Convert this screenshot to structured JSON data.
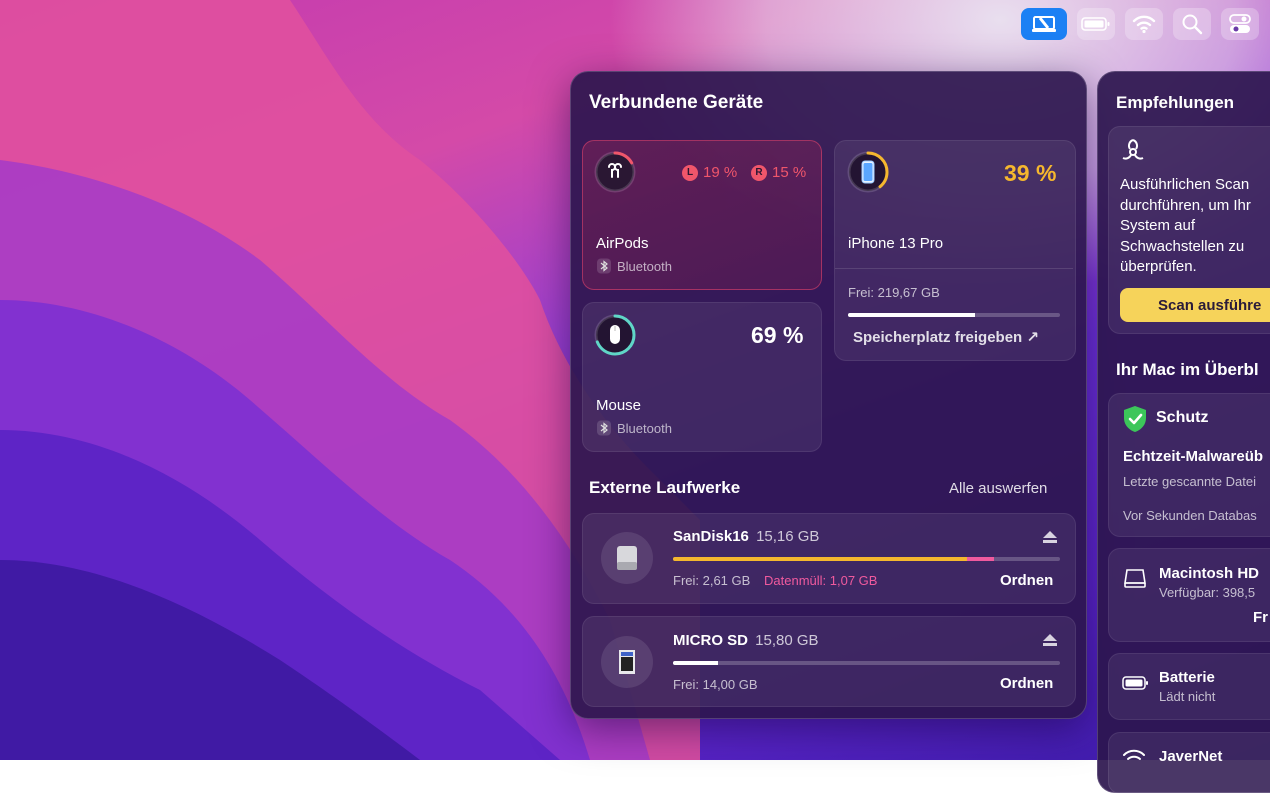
{
  "menubar": {
    "icons": [
      "clean-my-mac-icon",
      "battery-icon",
      "wifi-icon",
      "search-icon",
      "control-center-icon"
    ]
  },
  "connected": {
    "title": "Verbundene Geräte",
    "airpods": {
      "name": "AirPods",
      "connection": "Bluetooth",
      "left_label": "L",
      "left_pct": "19 %",
      "right_label": "R",
      "right_pct": "15 %",
      "ring_level": 0.17,
      "color": "#f0566b"
    },
    "iphone": {
      "name": "iPhone 13 Pro",
      "pct": "39 %",
      "level": 0.39,
      "color": "#f5b72e",
      "free": "Frei: 219,67 GB",
      "free_level": 0.6,
      "action": "Speicherplatz freigeben ↗"
    },
    "mouse": {
      "name": "Mouse",
      "connection": "Bluetooth",
      "pct": "69 %",
      "level": 0.69,
      "color": "#5fd6c7"
    }
  },
  "external": {
    "title": "Externe Laufwerke",
    "eject_all": "Alle auswerfen",
    "drives": [
      {
        "name": "SanDisk16",
        "size": "15,16 GB",
        "free": "Frei: 2,61 GB",
        "junk": "Datenmüll: 1,07 GB",
        "action": "Ordnen",
        "used_level": 0.76,
        "junk_level": 0.07
      },
      {
        "name": "MICRO SD",
        "size": "15,80 GB",
        "free": "Frei: 14,00 GB",
        "action": "Ordnen",
        "used_level": 0.115
      }
    ]
  },
  "recommendations": {
    "title": "Empfehlungen",
    "text_lines": [
      "Ausführlichen Scan",
      "durchführen, um Ihr",
      "System auf",
      "Schwachstellen zu",
      "überprüfen."
    ],
    "button": "Scan ausführe"
  },
  "overview": {
    "title": "Ihr Mac im Überbl",
    "protection": {
      "title": "Schutz",
      "subtitle": "Echtzeit-Malwareüb",
      "line1": "Letzte gescannte Datei",
      "line2": "Vor Sekunden Databas"
    },
    "disk": {
      "name": "Macintosh HD",
      "available": "Verfügbar: 398,5",
      "action": "Fr"
    },
    "battery": {
      "name": "Batterie",
      "status": "Lädt nicht"
    },
    "network": {
      "name": "JaverNet"
    }
  }
}
